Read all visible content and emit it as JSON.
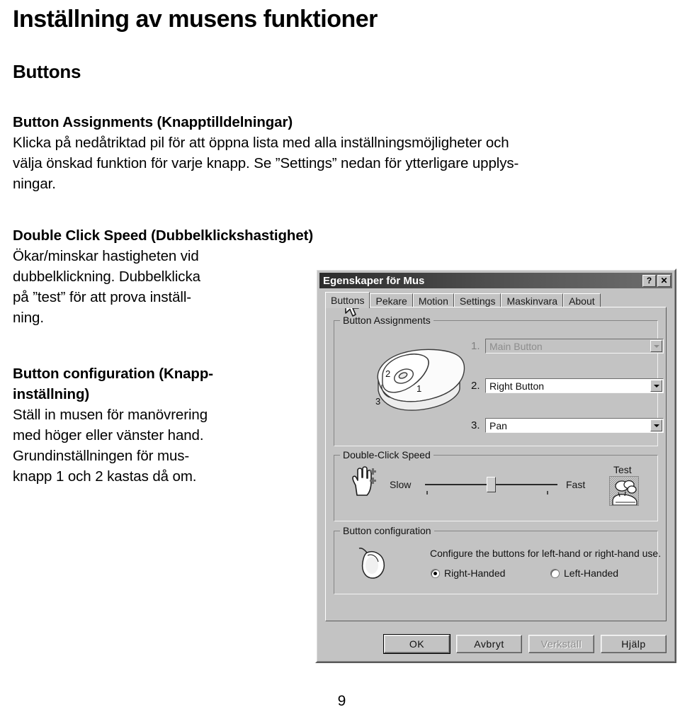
{
  "document": {
    "title": "Inställning av musens funktioner",
    "section_heading": "Buttons",
    "page_number": "9",
    "blocks": {
      "button_assignments": {
        "heading": "Button Assignments (Knapptilldelningar)",
        "lines": [
          "Klicka på nedåtriktad pil för att öppna lista med alla inställningsmöjligheter och",
          "välja önskad funktion för varje knapp. Se ”Settings” nedan för ytterligare upplys-",
          "ningar."
        ]
      },
      "double_click_speed": {
        "heading": "Double Click Speed (Dubbelklickshastighet)",
        "lines": [
          "Ökar/minskar hastigheten vid",
          "dubbelklickning. Dubbelklicka",
          "på ”test” för att prova inställ-",
          "ning."
        ]
      },
      "button_configuration": {
        "heading_line1": "Button configuration (Knapp-",
        "heading_line2": "inställning)",
        "lines": [
          "Ställ in musen för manövrering",
          "med höger eller vänster hand.",
          "Grundinställningen för mus-",
          "knapp 1 och 2 kastas då om."
        ]
      }
    }
  },
  "dialog": {
    "title": "Egenskaper för Mus",
    "titlebar_buttons": {
      "help": "?",
      "close": "✕"
    },
    "tabs": [
      {
        "label": "Buttons",
        "active": true
      },
      {
        "label": "Pekare",
        "active": false
      },
      {
        "label": "Motion",
        "active": false
      },
      {
        "label": "Settings",
        "active": false
      },
      {
        "label": "Maskinvara",
        "active": false
      },
      {
        "label": "About",
        "active": false
      }
    ],
    "button_assignments": {
      "legend": "Button Assignments",
      "mouse_labels": [
        "1",
        "2",
        "3"
      ],
      "rows": [
        {
          "index": "1.",
          "value": "Main Button",
          "disabled": true
        },
        {
          "index": "2.",
          "value": "Right Button",
          "disabled": false
        },
        {
          "index": "3.",
          "value": "Pan",
          "disabled": false
        }
      ]
    },
    "double_click_speed": {
      "legend": "Double-Click Speed",
      "slow_label": "Slow",
      "fast_label": "Fast",
      "test_label": "Test",
      "slider_percent": 50
    },
    "button_configuration": {
      "legend": "Button configuration",
      "description": "Configure the buttons for left-hand or right-hand use.",
      "options": [
        {
          "label": "Right-Handed",
          "checked": true
        },
        {
          "label": "Left-Handed",
          "checked": false
        }
      ]
    },
    "action_buttons": [
      {
        "label": "OK",
        "state": "default"
      },
      {
        "label": "Avbryt",
        "state": "normal"
      },
      {
        "label": "Verkställ",
        "state": "disabled"
      },
      {
        "label": "Hjälp",
        "state": "normal"
      }
    ]
  },
  "colors": {
    "dialog_face": "#c3c3c3",
    "titlebar_dark": "#2b2b2b",
    "field_white": "#ffffff",
    "disabled_text": "#8d8d8d"
  }
}
